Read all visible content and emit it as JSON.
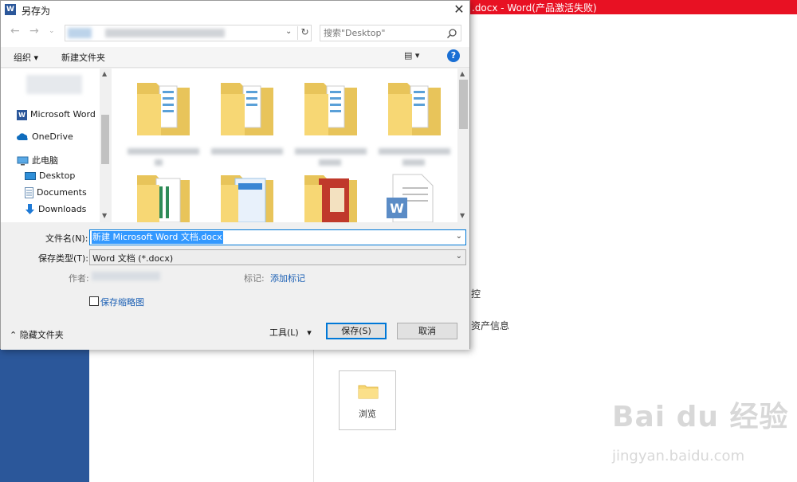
{
  "word": {
    "title": ".docx -  Word(产品激活失败)",
    "peek_text_1": "控",
    "peek_text_2": "资产信息",
    "browse_label": "浏览"
  },
  "watermark": {
    "logo": "Bai du 经验",
    "url": "jingyan.baidu.com"
  },
  "dialog": {
    "title": "另存为",
    "icon_letter": "W",
    "search_placeholder": "搜索\"Desktop\"",
    "toolbar": {
      "organize": "组织 ▾",
      "new_folder": "新建文件夹",
      "help": "?"
    },
    "nav": [
      {
        "label": "Microsoft Word",
        "icon": "word-icon"
      },
      {
        "label": "OneDrive",
        "icon": "cloud-icon"
      },
      {
        "label": "此电脑",
        "icon": "computer-icon"
      },
      {
        "label": "Desktop",
        "icon": "desktop-icon"
      },
      {
        "label": "Documents",
        "icon": "documents-icon"
      },
      {
        "label": "Downloads",
        "icon": "download-icon"
      }
    ],
    "fields": {
      "filename_label": "文件名(N):",
      "filename_value": "新建 Microsoft Word 文档.docx",
      "filetype_label": "保存类型(T):",
      "filetype_value": "Word 文档 (*.docx)",
      "author_label": "作者:",
      "tags_label": "标记:",
      "tags_link": "添加标记",
      "thumbnail_label": "保存缩略图"
    },
    "buttons": {
      "hide_folders": "隐藏文件夹",
      "tools": "工具(L)",
      "save": "保存(S)",
      "cancel": "取消"
    }
  },
  "colors": {
    "word_red": "#e81123",
    "word_blue": "#2b579a",
    "folder": "#f7d774",
    "accent": "#0078d7"
  }
}
